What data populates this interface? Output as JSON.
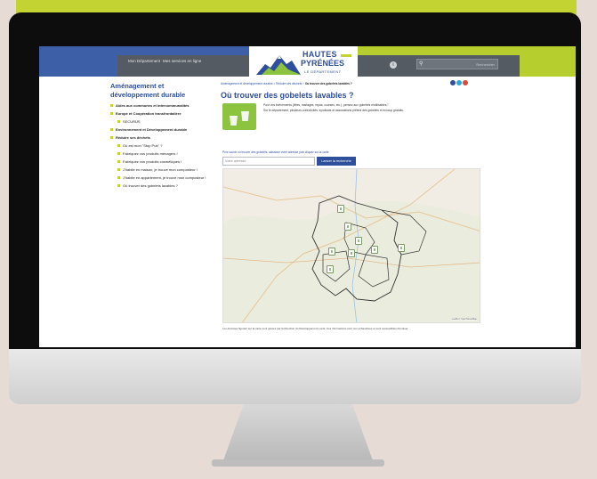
{
  "header": {
    "nav_links": [
      "Mon Département",
      "Mes services en ligne"
    ],
    "logo_line1": "HAUTES",
    "logo_line2": "PYRÉNÉES",
    "logo_line3": "LE DÉPARTEMENT",
    "search_placeholder": "Rechercher"
  },
  "sidebar": {
    "title": "Aménagement et développement durable",
    "items": [
      {
        "label": "Aides aux communes et intercommunalités",
        "level": 1
      },
      {
        "label": "Europe et Coopération transfrontalière",
        "level": 1
      },
      {
        "label": "SECURUS",
        "level": 2
      },
      {
        "label": "Environnement et Développement durable",
        "level": 1
      },
      {
        "label": "Réduire ses déchets",
        "level": 1
      },
      {
        "label": "Où est mon \"Stop Pub\" ?",
        "level": 2
      },
      {
        "label": "Fabriquez vos produits ménagers !",
        "level": 2
      },
      {
        "label": "Fabriquez vos produits cosmétiques !",
        "level": 2
      },
      {
        "label": "J'habite en maison, je trouve mon composteur !",
        "level": 2
      },
      {
        "label": "J'habite en appartement, je trouve mon composteur !",
        "level": 2
      },
      {
        "label": "Où trouver des gobelets lavables ?",
        "level": 2
      }
    ]
  },
  "breadcrumb": {
    "path": "Aménagement et développement durable > Réduire ses déchets > ",
    "current": "Où trouver des gobelets lavables ?"
  },
  "main": {
    "title": "Où trouver des gobelets lavables ?",
    "intro_p1": "Pour vos événements (fêtes, mariages, repas, courses, etc.), pensez aux gobelets réutilisables !",
    "intro_p2": "Sur le département, plusieurs collectivités, syndicats et associations prêtent des gobelets et écocup gratuits.",
    "search_hint": "Pour savoir où trouver des gobelets, saisissez votre adresse puis cliquez sur la carte.",
    "address_placeholder": "Votre adresse",
    "search_button": "Lancer la recherche",
    "map_attribution": "Leaflet | OpenStreetMap",
    "footnote": "Les données figurant sur la carte sont gérées par la Direction du Développement Local. Ces informations sont non exhaustives et sont susceptibles d'évoluer."
  },
  "colors": {
    "brand_blue": "#2e4f9b",
    "brand_green": "#c3d331",
    "topbar_blue": "#3d5fa7"
  }
}
